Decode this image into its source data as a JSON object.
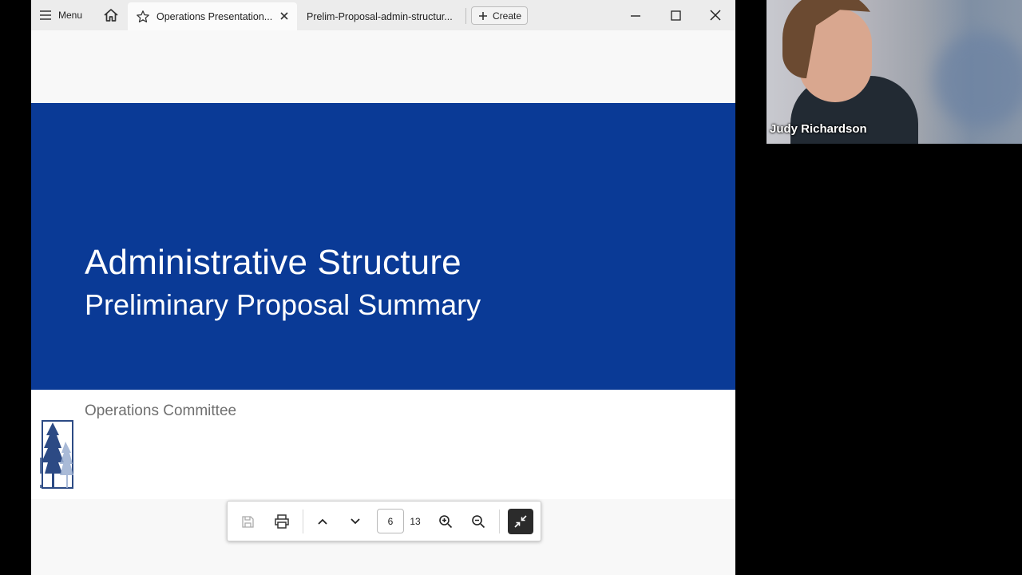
{
  "titlebar": {
    "menu_label": "Menu",
    "tabs": [
      {
        "label": "Operations Presentation...",
        "active": true,
        "favorited": true
      },
      {
        "label": "Prelim-Proposal-admin-structur...",
        "active": false
      }
    ],
    "create_label": "Create"
  },
  "slide": {
    "title": "Administrative Structure",
    "subtitle": "Preliminary Proposal Summary",
    "committee": "Operations Committee",
    "band_color": "#0a3a96"
  },
  "toolbar": {
    "current_page": "6",
    "total_pages": "13"
  },
  "video": {
    "participant_name": "Judy Richardson"
  },
  "icons": {
    "menu": "hamburger-icon",
    "home": "home-icon",
    "favorite": "star-icon",
    "close_tab": "close-icon",
    "create": "plus-icon",
    "minimize": "minimize-icon",
    "maximize": "maximize-icon",
    "close_window": "close-icon",
    "save": "save-icon",
    "print": "printer-icon",
    "prev_page": "chevron-up-icon",
    "next_page": "chevron-down-icon",
    "zoom_in": "zoom-in-icon",
    "zoom_out": "zoom-out-icon",
    "exit_fullscreen": "exit-fullscreen-icon"
  }
}
